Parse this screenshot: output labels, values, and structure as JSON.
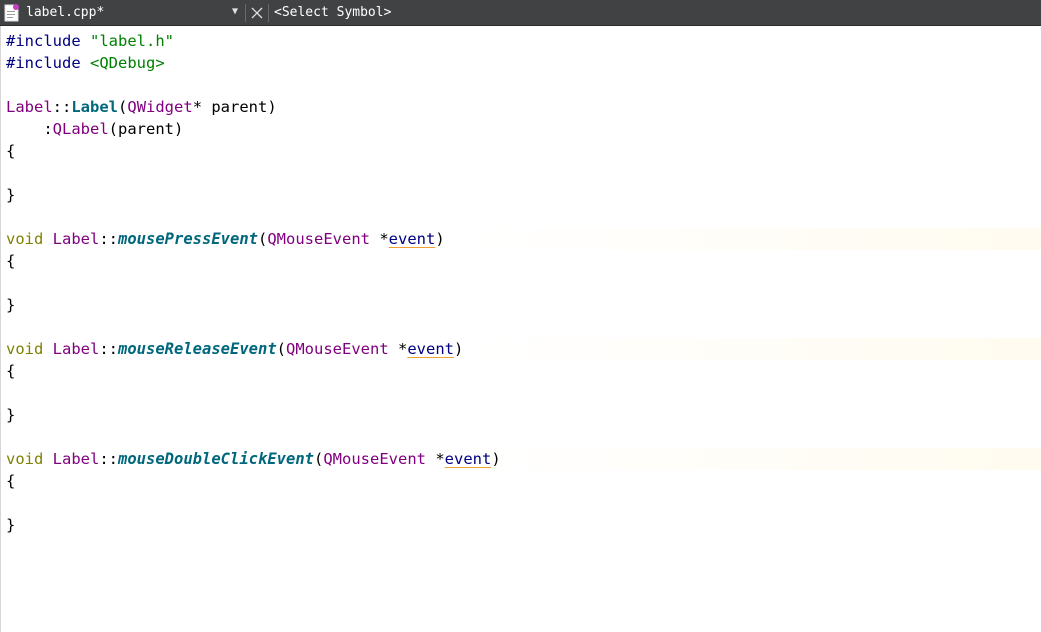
{
  "toolbar": {
    "file_name": "label.cpp*",
    "symbol_selector": "<Select Symbol>"
  },
  "icons": {
    "document": "document-icon",
    "dropdown": "dropdown-arrow-icon",
    "close": "close-icon"
  },
  "code": {
    "include1": {
      "directive": "#include",
      "path": "\"label.h\""
    },
    "include2": {
      "directive": "#include",
      "path": "<QDebug>"
    },
    "ctor": {
      "cls": "Label",
      "sep": "::",
      "name": "Label",
      "open": "(",
      "ptype": "QWidget",
      "rest": "* parent)"
    },
    "init": {
      "indent": "    :",
      "base": "QLabel",
      "rest": "(parent)"
    },
    "fn1": {
      "ret": "void",
      "cls": "Label",
      "sep": "::",
      "name": "mousePressEvent",
      "open": "(",
      "ptype": "QMouseEvent",
      "star": " *",
      "param": "event",
      "close": ")"
    },
    "fn2": {
      "ret": "void",
      "cls": "Label",
      "sep": "::",
      "name": "mouseReleaseEvent",
      "open": "(",
      "ptype": "QMouseEvent",
      "star": " *",
      "param": "event",
      "close": ")"
    },
    "fn3": {
      "ret": "void",
      "cls": "Label",
      "sep": "::",
      "name": "mouseDoubleClickEvent",
      "open": "(",
      "ptype": "QMouseEvent",
      "star": " *",
      "param": "event",
      "close": ")"
    },
    "brace_open": "{",
    "brace_close": "}"
  },
  "colors": {
    "toolbar_bg": "#404244",
    "preprocessor": "#000080",
    "string": "#008000",
    "type": "#800080",
    "keyword": "#808000",
    "function": "#00677c",
    "warning_underline": "#f0a030"
  }
}
